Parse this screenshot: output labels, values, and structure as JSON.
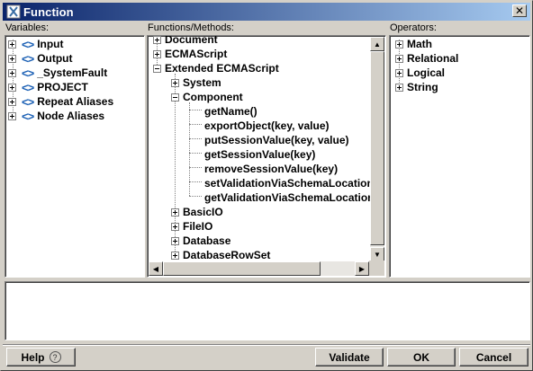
{
  "window": {
    "title": "Function",
    "close_glyph": "✕"
  },
  "variables": {
    "label": "Variables:",
    "items": [
      {
        "label": "Input",
        "icon": "diamond-brackets-icon"
      },
      {
        "label": "Output",
        "icon": "diamond-brackets-icon"
      },
      {
        "label": "_SystemFault",
        "icon": "diamond-brackets-icon"
      },
      {
        "label": "PROJECT",
        "icon": "diamond-brackets-icon"
      },
      {
        "label": "Repeat Aliases",
        "icon": "diamond-brackets-icon"
      },
      {
        "label": "Node Aliases",
        "icon": "diamond-brackets-icon"
      }
    ],
    "icon_glyph": "<>"
  },
  "functions": {
    "label": "Functions/Methods:",
    "items": [
      {
        "label": "Document"
      },
      {
        "label": "ECMAScript"
      },
      {
        "label": "Extended ECMAScript"
      },
      {
        "label": "System"
      },
      {
        "label": "Component"
      },
      {
        "label": "getName()"
      },
      {
        "label": "exportObject(key, value)"
      },
      {
        "label": "putSessionValue(key, value)"
      },
      {
        "label": "getSessionValue(key)"
      },
      {
        "label": "removeSessionValue(key)"
      },
      {
        "label": "setValidationViaSchemaLocation"
      },
      {
        "label": "getValidationViaSchemaLocation"
      },
      {
        "label": "BasicIO"
      },
      {
        "label": "FileIO"
      },
      {
        "label": "Database"
      },
      {
        "label": "DatabaseRowSet"
      }
    ]
  },
  "operators": {
    "label": "Operators:",
    "items": [
      {
        "label": "Math"
      },
      {
        "label": "Relational"
      },
      {
        "label": "Logical"
      },
      {
        "label": "String"
      }
    ]
  },
  "expression": {
    "value": ""
  },
  "buttons": {
    "help": "Help",
    "help_glyph": "?",
    "validate": "Validate",
    "ok": "OK",
    "cancel": "Cancel"
  },
  "scroll": {
    "up": "▲",
    "down": "▼",
    "left": "◀",
    "right": "▶"
  },
  "colors": {
    "titlebar_start": "#0a246a",
    "titlebar_end": "#a6caf0",
    "icon_blue": "#1a5fb4",
    "face": "#d4d0c8"
  }
}
